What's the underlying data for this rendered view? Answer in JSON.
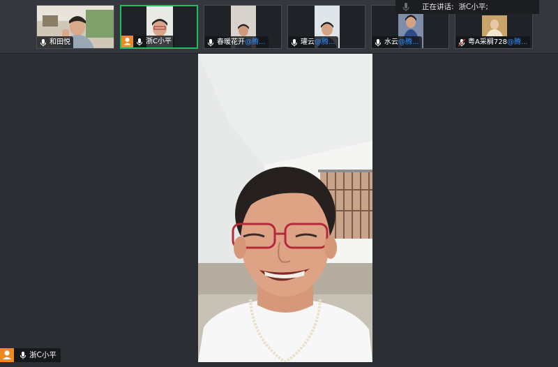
{
  "participants": [
    {
      "name": "和田悦",
      "handle": ""
    },
    {
      "name": "浙C小平",
      "handle": ""
    },
    {
      "name": "春暖花开",
      "handle": "@腾..."
    },
    {
      "name": "瓘云",
      "handle": "@腾..."
    },
    {
      "name": "水云",
      "handle": "@腾..."
    },
    {
      "name": "粤A采榈728",
      "handle": "@腾..."
    }
  ],
  "speaking": {
    "label": "正在讲话:",
    "name": "浙C小平;"
  },
  "main_speaker": {
    "name": "浙C小平"
  },
  "colors": {
    "accent_active": "#1fbf5f",
    "host_badge": "#f08a1e",
    "handle": "#2f8fff",
    "background": "#2b2e33"
  }
}
